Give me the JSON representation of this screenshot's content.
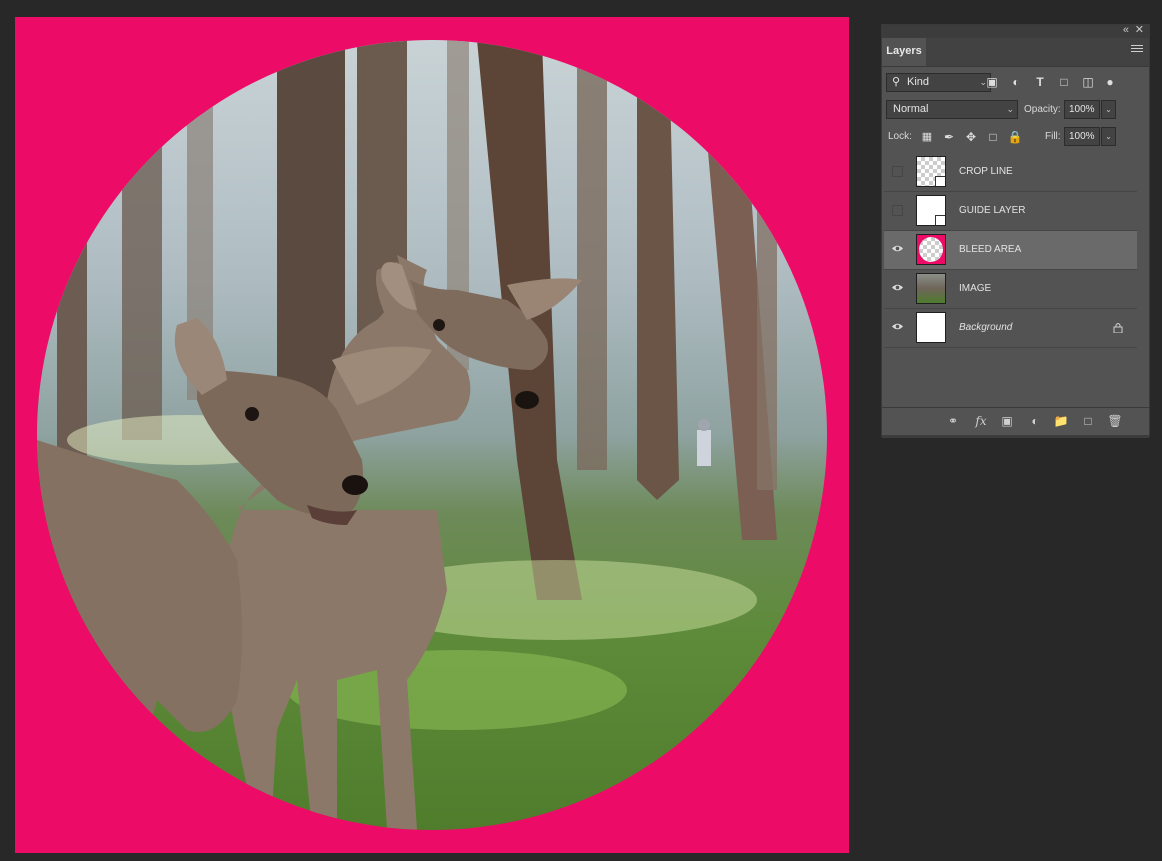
{
  "panel": {
    "tab_label": "Layers",
    "collapse_icon": "double-chevron-left-icon",
    "close_icon": "close-icon",
    "menu_icon": "hamburger-menu-icon"
  },
  "filter": {
    "kind_label": "Kind",
    "icons": [
      "image-filter-icon",
      "adjustment-filter-icon",
      "type-filter-icon",
      "shape-filter-icon",
      "smart-object-filter-icon",
      "filter-toggle-icon"
    ]
  },
  "blend": {
    "mode": "Normal",
    "opacity_label": "Opacity:",
    "opacity_value": "100%"
  },
  "lock": {
    "label": "Lock:",
    "fill_label": "Fill:",
    "fill_value": "100%"
  },
  "layers": [
    {
      "name": "CROP LINE",
      "visible": false,
      "selected": false
    },
    {
      "name": "GUIDE LAYER",
      "visible": false,
      "selected": false
    },
    {
      "name": "BLEED AREA",
      "visible": true,
      "selected": true
    },
    {
      "name": "IMAGE",
      "visible": true,
      "selected": false
    },
    {
      "name": "Background",
      "visible": true,
      "selected": false,
      "locked": true
    }
  ],
  "footer_icons": [
    "link-layers-icon",
    "fx-icon",
    "add-mask-icon",
    "adjustment-layer-icon",
    "new-group-icon",
    "new-layer-icon",
    "delete-icon"
  ],
  "canvas": {
    "bleed_color": "#ec0c68"
  }
}
